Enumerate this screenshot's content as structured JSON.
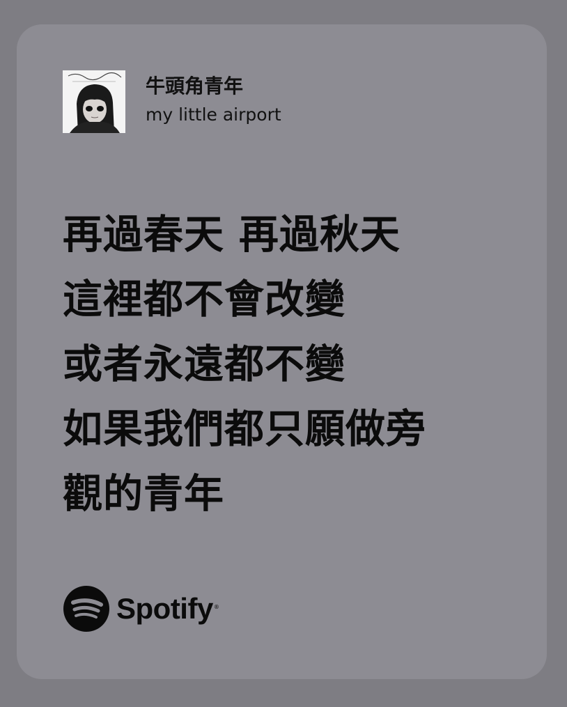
{
  "colors": {
    "background": "#7e7d83",
    "card": "#8d8c93",
    "text": "#0b0b0b"
  },
  "track": {
    "title": "牛頭角青年",
    "artist": "my little airport",
    "cover_icon": "album-cover-image"
  },
  "lyrics": [
    "再過春天 再過秋天",
    "這裡都不會改變",
    "或者永遠都不變",
    "如果我們都只願做旁",
    "觀的青年"
  ],
  "brand": {
    "name": "Spotify",
    "icon": "spotify-logo-icon"
  }
}
